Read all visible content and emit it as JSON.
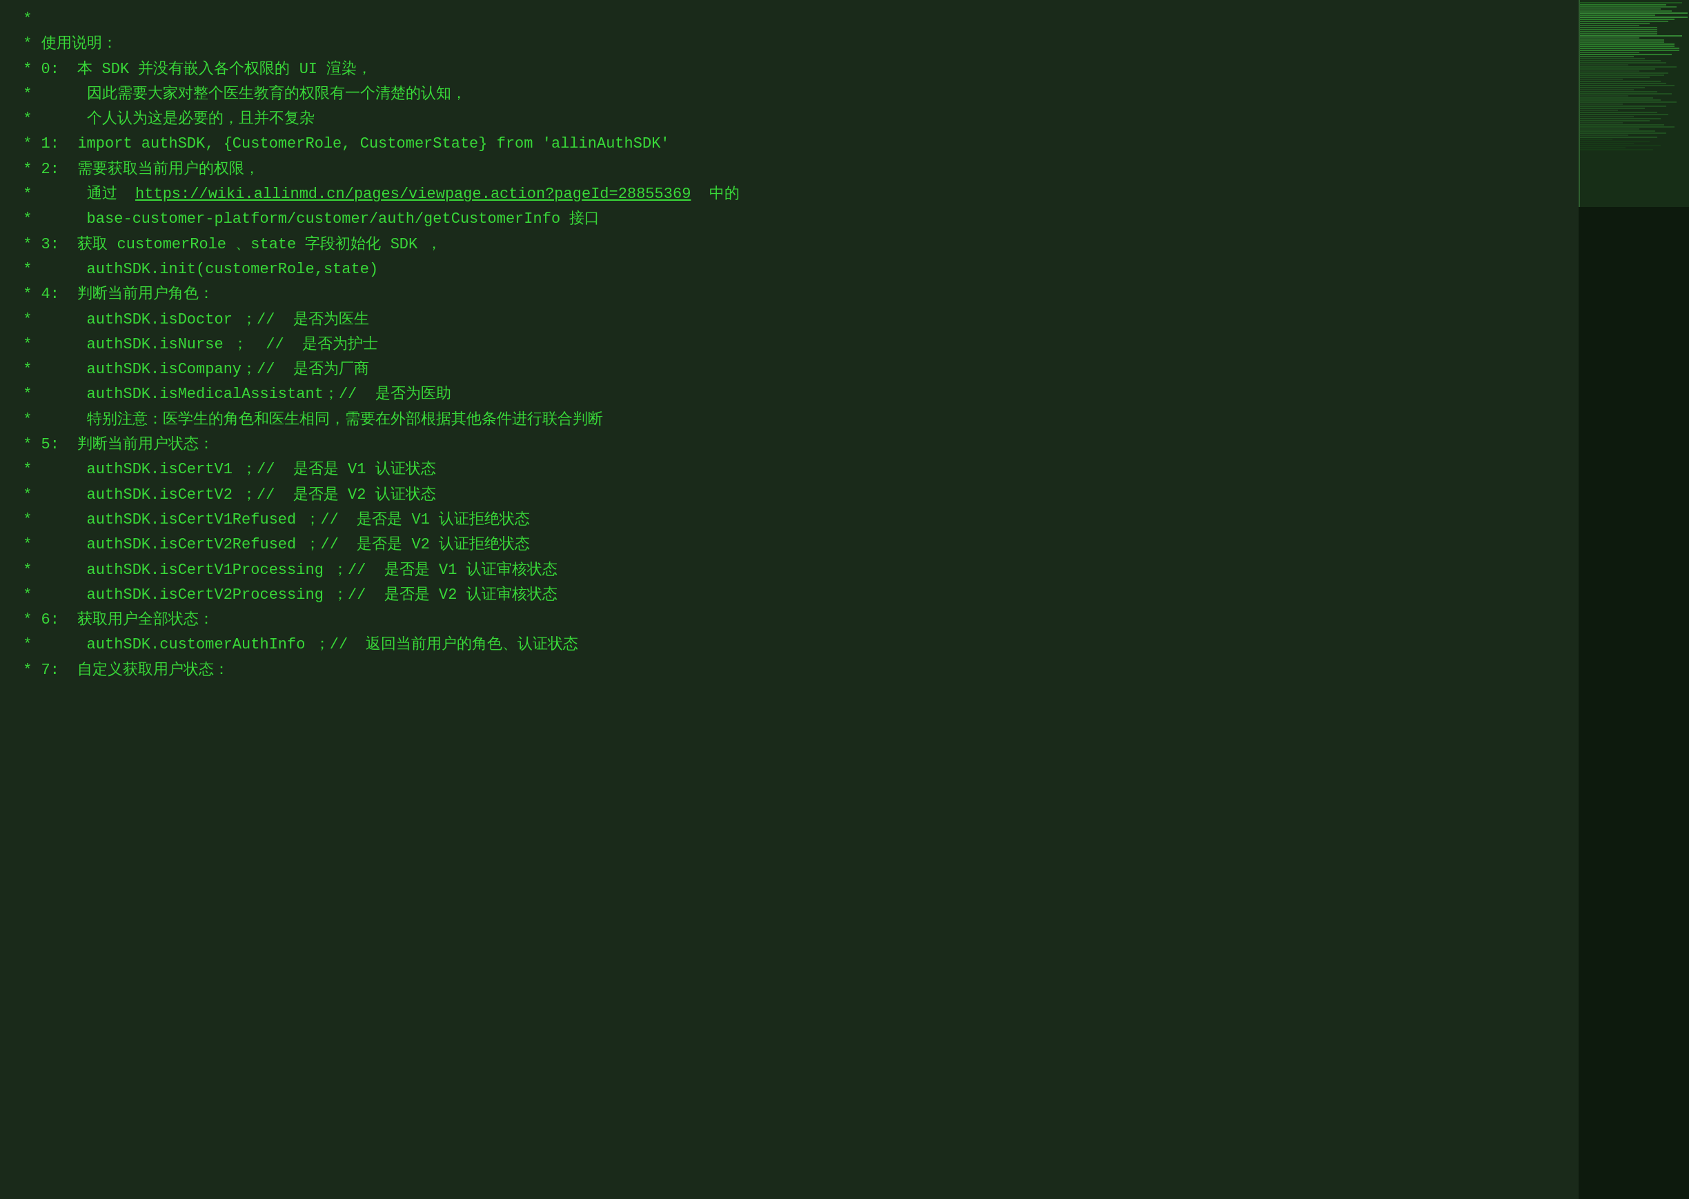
{
  "editor": {
    "background": "#1a2a1a",
    "text_color": "#39d939",
    "font_size": "22px"
  },
  "lines": [
    {
      "prefix": " *",
      "indent": "",
      "content": ""
    },
    {
      "prefix": " *",
      "indent": " ",
      "content": "使用说明："
    },
    {
      "prefix": " *",
      "indent": " ",
      "content": "0:  本 SDK 并没有嵌入各个权限的 UI 渲染，"
    },
    {
      "prefix": " *",
      "indent": "     ",
      "content": "因此需要大家对整个医生教育的权限有一个清楚的认知，"
    },
    {
      "prefix": " *",
      "indent": "     ",
      "content": "个人认为这是必要的，且并不复杂"
    },
    {
      "prefix": " *",
      "indent": " ",
      "content": "1:  import authSDK, {CustomerRole, CustomerState} from 'allinAuthSDK'"
    },
    {
      "prefix": " *",
      "indent": " ",
      "content": "2:  需要获取当前用户的权限，"
    },
    {
      "prefix": " *",
      "indent": "     ",
      "content": "通过  https://wiki.allinmd.cn/pages/viewpage.action?pageId=28855369  中的",
      "has_link": true,
      "link_text": "https://wiki.allinmd.cn/pages/viewpage.action?pageId=28855369"
    },
    {
      "prefix": " *",
      "indent": "     ",
      "content": "base-customer-platform/customer/auth/getCustomerInfo 接口"
    },
    {
      "prefix": " *",
      "indent": " ",
      "content": "3:  获取 customerRole 、state 字段初始化 SDK ，"
    },
    {
      "prefix": " *",
      "indent": "     ",
      "content": "authSDK.init(customerRole,state)"
    },
    {
      "prefix": " *",
      "indent": " ",
      "content": "4:  判断当前用户角色："
    },
    {
      "prefix": " *",
      "indent": "     ",
      "content": "authSDK.isDoctor ；//  是否为医生"
    },
    {
      "prefix": " *",
      "indent": "     ",
      "content": "authSDK.isNurse ；  //  是否为护士"
    },
    {
      "prefix": " *",
      "indent": "     ",
      "content": "authSDK.isCompany；//  是否为厂商"
    },
    {
      "prefix": " *",
      "indent": "     ",
      "content": "authSDK.isMedicalAssistant；//  是否为医助"
    },
    {
      "prefix": " *",
      "indent": "     ",
      "content": "特别注意：医学生的角色和医生相同，需要在外部根据其他条件进行联合判断"
    },
    {
      "prefix": " *",
      "indent": " ",
      "content": "5:  判断当前用户状态："
    },
    {
      "prefix": " *",
      "indent": "     ",
      "content": "authSDK.isCertV1 ；//  是否是 V1 认证状态"
    },
    {
      "prefix": " *",
      "indent": "     ",
      "content": "authSDK.isCertV2 ；//  是否是 V2 认证状态"
    },
    {
      "prefix": " *",
      "indent": "     ",
      "content": "authSDK.isCertV1Refused ；//  是否是 V1 认证拒绝状态"
    },
    {
      "prefix": " *",
      "indent": "     ",
      "content": "authSDK.isCertV2Refused ；//  是否是 V2 认证拒绝状态"
    },
    {
      "prefix": " *",
      "indent": "     ",
      "content": "authSDK.isCertV1Processing ；//  是否是 V1 认证审核状态"
    },
    {
      "prefix": " *",
      "indent": "     ",
      "content": "authSDK.isCertV2Processing ；//  是否是 V2 认证审核状态"
    },
    {
      "prefix": " *",
      "indent": " ",
      "content": "6:  获取用户全部状态："
    },
    {
      "prefix": " *",
      "indent": "     ",
      "content": "authSDK.customerAuthInfo ；//  返回当前用户的角色、认证状态"
    },
    {
      "prefix": " *",
      "indent": " ",
      "content": "7:  自定义获取用户状态："
    }
  ]
}
